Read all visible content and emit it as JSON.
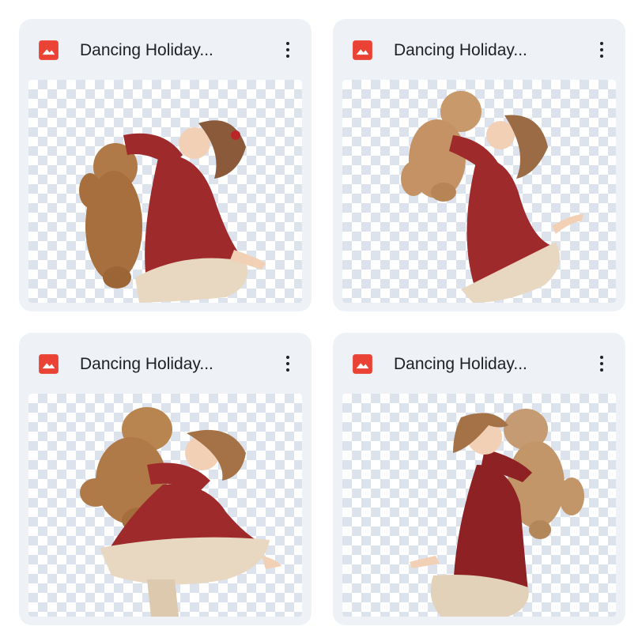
{
  "files": [
    {
      "name": "Dancing Holiday...",
      "icon": "image-file-icon"
    },
    {
      "name": "Dancing Holiday...",
      "icon": "image-file-icon"
    },
    {
      "name": "Dancing Holiday...",
      "icon": "image-file-icon"
    },
    {
      "name": "Dancing Holiday...",
      "icon": "image-file-icon"
    }
  ],
  "colors": {
    "card_background": "#eef1f6",
    "icon_red": "#ea4335",
    "text": "#202124",
    "checker": "#dde3ec",
    "dress": "#9e2a2b",
    "teddy": "#b07a48",
    "ruffle": "#e8d8c2"
  }
}
